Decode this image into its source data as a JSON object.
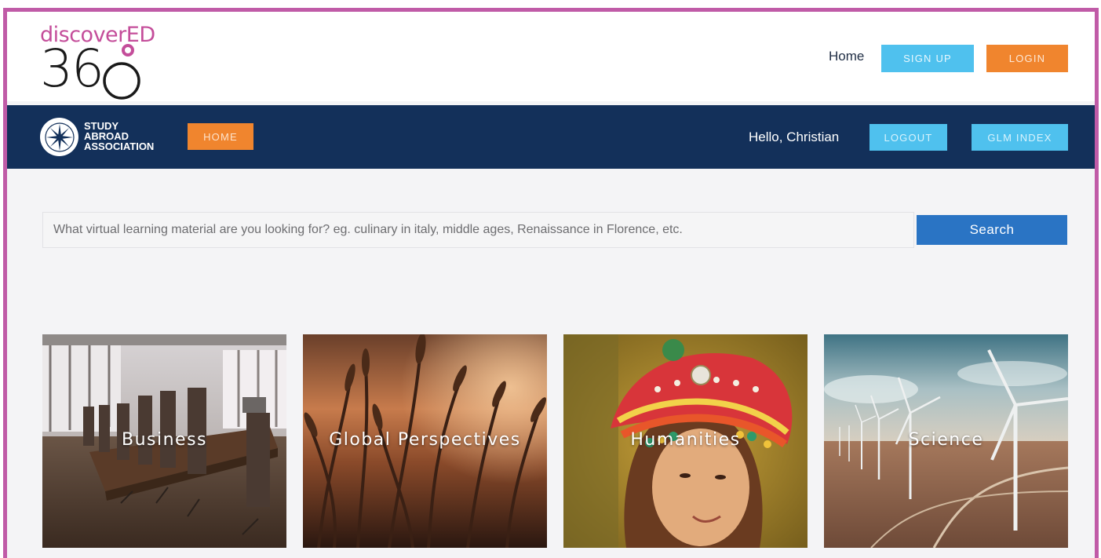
{
  "brand": {
    "logo_word": "discoverED",
    "logo_number": "36",
    "accent_color": "#c44d9a"
  },
  "top_nav": {
    "home_label": "Home",
    "signup_label": "SIGN UP",
    "login_label": "LOGIN"
  },
  "nav_bar": {
    "association_lines": [
      "STUDY",
      "ABROAD",
      "ASSOCIATION"
    ],
    "home_label": "HOME",
    "greeting": "Hello, Christian",
    "logout_label": "LOGOUT",
    "glm_label": "GLM INDEX",
    "background_color": "#13305a"
  },
  "search": {
    "placeholder": "What virtual learning material are you looking for? eg. culinary in italy, middle ages, Renaissance in Florence, etc.",
    "value": "",
    "button_label": "Search"
  },
  "categories": [
    {
      "label": "Business",
      "icon": "boardroom-photo"
    },
    {
      "label": "Global Perspectives",
      "icon": "wheat-field-photo"
    },
    {
      "label": "Humanities",
      "icon": "portrait-headdress-photo"
    },
    {
      "label": "Science",
      "icon": "wind-turbines-photo"
    }
  ],
  "colors": {
    "frame_border": "#c05ba7",
    "orange": "#f0852e",
    "light_blue": "#4fc1ee",
    "search_blue": "#2a74c4"
  }
}
